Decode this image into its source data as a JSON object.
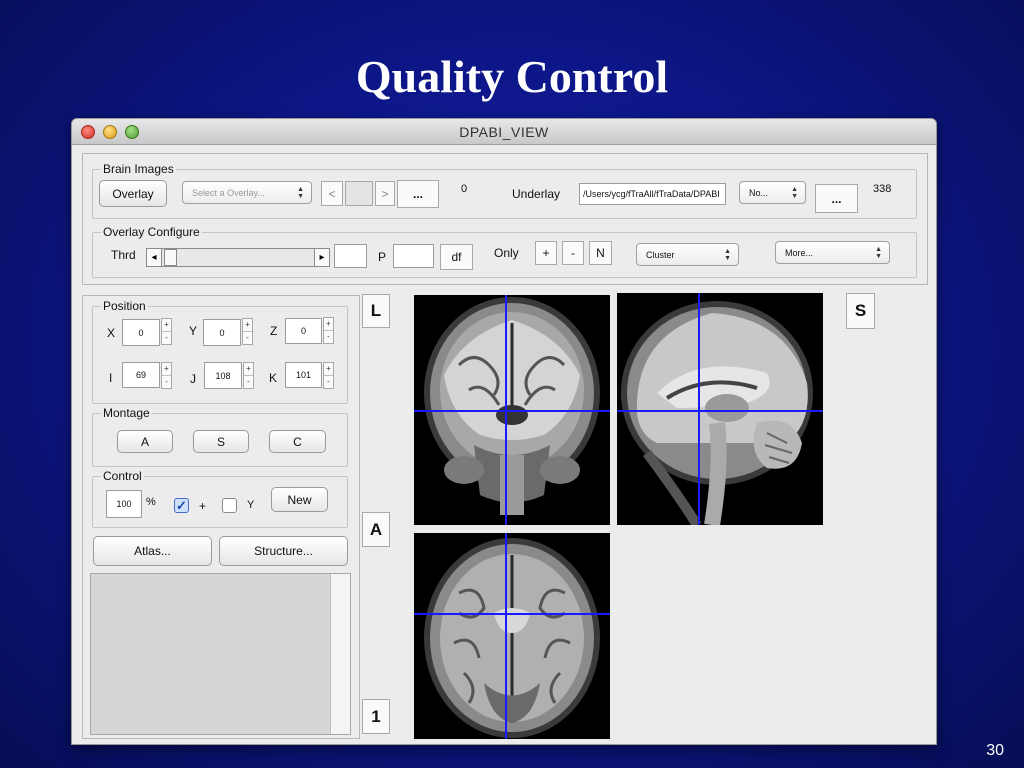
{
  "slide": {
    "title": "Quality Control",
    "page_number": "30"
  },
  "window": {
    "title": "DPABI_VIEW"
  },
  "brain_images": {
    "group_label": "Brain Images",
    "overlay_button": "Overlay",
    "overlay_select": "Select a Overlay...",
    "prev_label": "<",
    "next_label": ">",
    "browse_label": "...",
    "overlay_index": "0",
    "underlay_label": "Underlay",
    "underlay_path": "/Users/ycg/fTraAll/fTraData/DPABI",
    "underlay_option": "No...",
    "underlay_browse_label": "...",
    "underlay_count": "338"
  },
  "overlay_configure": {
    "group_label": "Overlay Configure",
    "thrd_label": "Thrd",
    "thrd_value": "",
    "p_label": "P",
    "p_value": "",
    "df_label": "df",
    "only_label": "Only",
    "plus_label": "+",
    "minus_label": "-",
    "n_label": "N",
    "cluster_option": "Cluster",
    "more_option": "More...",
    "slider_left_arrow": "◂",
    "slider_right_arrow": "▸"
  },
  "position": {
    "group_label": "Position",
    "x_label": "X",
    "x_value": "0",
    "y_label": "Y",
    "y_value": "0",
    "z_label": "Z",
    "z_value": "0",
    "i_label": "I",
    "i_value": "69",
    "j_label": "J",
    "j_value": "108",
    "k_label": "K",
    "k_value": "101",
    "spin_up": "+",
    "spin_down": "-"
  },
  "montage": {
    "group_label": "Montage",
    "a_label": "A",
    "s_label": "S",
    "c_label": "C"
  },
  "control": {
    "group_label": "Control",
    "percent_value": "100",
    "percent_label": "%",
    "plus_checked": true,
    "check_mark": "✓",
    "plus_label": "+",
    "y_checked": false,
    "y_label": "Y",
    "new_label": "New"
  },
  "atlas_label": "Atlas...",
  "structure_label": "Structure...",
  "orientation": {
    "left": "L",
    "superior": "S",
    "anterior": "A",
    "one": "1"
  },
  "colors": {
    "crosshair": "#1a1aff",
    "slide_bg": "#0d178a"
  }
}
